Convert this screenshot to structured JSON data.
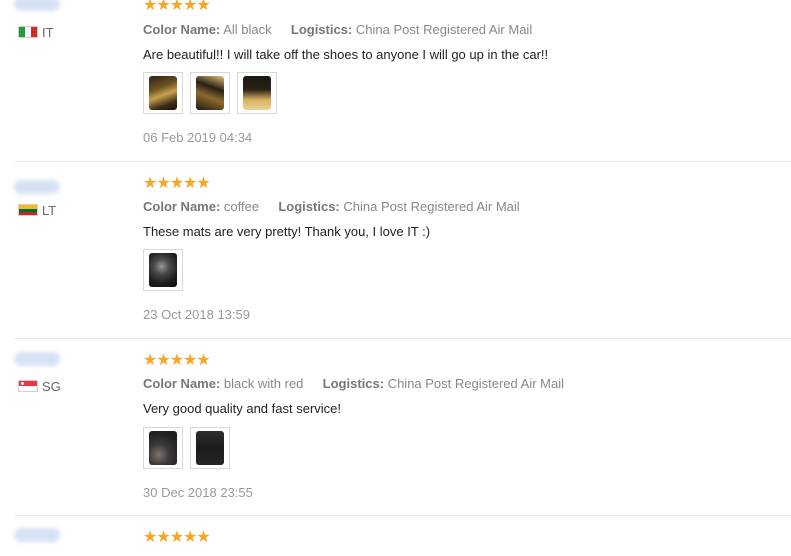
{
  "reviews": [
    {
      "country": "IT",
      "rating_stars": "★★★★★",
      "rating": 5,
      "color_label": "Color Name:",
      "color_value": "All black",
      "logistics_label": "Logistics:",
      "logistics_value": "China Post Registered Air Mail",
      "text": "Are beautiful!! I will take off the shoes to anyone I will go up in the car!!",
      "photo_count": 3,
      "date": "06 Feb 2019 04:34"
    },
    {
      "country": "LT",
      "rating_stars": "★★★★★",
      "rating": 5,
      "color_label": "Color Name:",
      "color_value": "coffee",
      "logistics_label": "Logistics:",
      "logistics_value": "China Post Registered Air Mail",
      "text": "These mats are very pretty! Thank you, I love IT :)",
      "photo_count": 1,
      "date": "23 Oct 2018 13:59"
    },
    {
      "country": "SG",
      "rating_stars": "★★★★★",
      "rating": 5,
      "color_label": "Color Name:",
      "color_value": "black with red",
      "logistics_label": "Logistics:",
      "logistics_value": "China Post Registered Air Mail",
      "text": "Very good quality and fast service!",
      "photo_count": 2,
      "date": "30 Dec 2018 23:55"
    },
    {
      "rating_stars": "★★★★★",
      "rating": 5
    }
  ],
  "colors": {
    "star": "#f5a623",
    "divider": "#e8e8e8",
    "meta_text": "#888888",
    "date_text": "#999999"
  }
}
